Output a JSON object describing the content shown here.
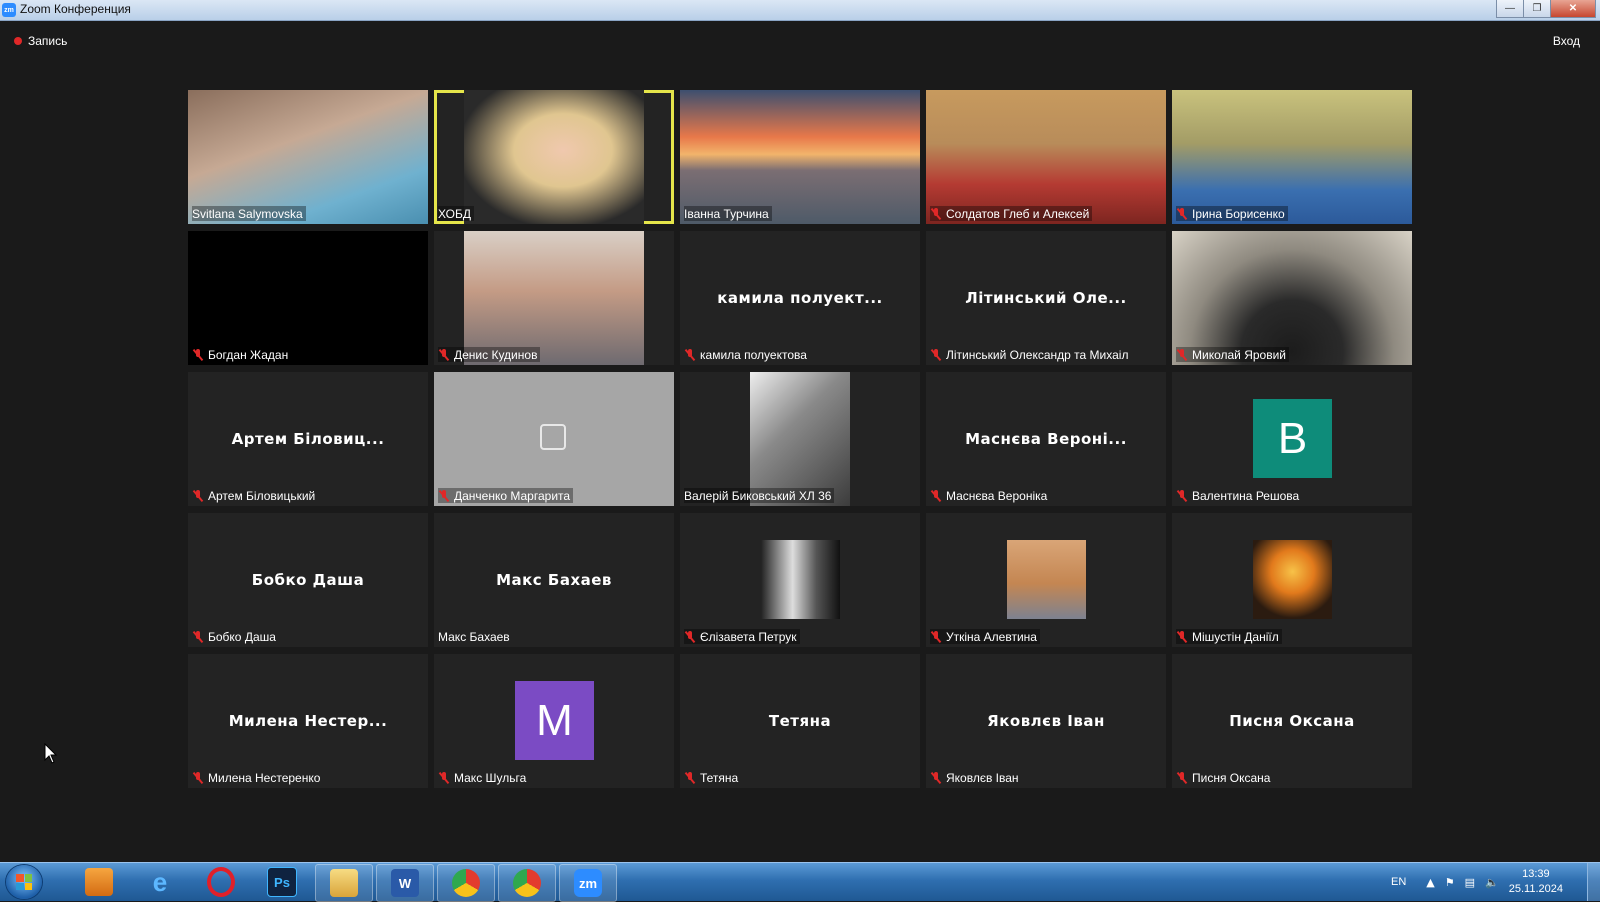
{
  "window": {
    "title": "Zoom Конференция",
    "app_icon": "zm"
  },
  "topbar": {
    "recording_label": "Запись",
    "enter_label": "Вход"
  },
  "participants": [
    {
      "name": "Svitlana Salymovska",
      "muted": false,
      "video": "woman-turquoise"
    },
    {
      "name": "ХОБД",
      "muted": false,
      "video": "woman-blonde",
      "active": true
    },
    {
      "name": "Іванна Турчина",
      "muted": false,
      "video": "golden-gate"
    },
    {
      "name": "Солдатов Глеб и Алексей",
      "muted": true,
      "video": "boy-red"
    },
    {
      "name": "Ірина Борисенко",
      "muted": true,
      "video": "woman-classroom"
    },
    {
      "name": "Богдан Жадан",
      "muted": true,
      "video": "black"
    },
    {
      "name": "Денис Кудинов",
      "muted": true,
      "video": "boy-hand"
    },
    {
      "name": "камила полуектова",
      "display": "камила полуект...",
      "muted": true
    },
    {
      "name": "Літинський Олександр та Михаіл",
      "display": "Літинський Оле...",
      "muted": true
    },
    {
      "name": "Миколай Яровий",
      "muted": true,
      "video": "dark-window"
    },
    {
      "name": "Артем Біловицький",
      "display": "Артем Біловиц...",
      "muted": true
    },
    {
      "name": "Данченко Маргарита",
      "muted": true,
      "video": "grey-camera"
    },
    {
      "name": "Валерій Биковський ХЛ 36",
      "muted": false,
      "video": "ceiling"
    },
    {
      "name": "Маснєва Вероніка",
      "display": "Маснєва Вероні...",
      "muted": true
    },
    {
      "name": "Валентина Решова",
      "muted": true,
      "letter": "В",
      "letter_color": "#0e8c7a"
    },
    {
      "name": "Бобко Даша",
      "display": "Бобко Даша",
      "muted": true
    },
    {
      "name": "Макс Бахаев",
      "display": "Макс Бахаев",
      "muted": false
    },
    {
      "name": "Єлізавета Петрук",
      "muted": true,
      "video": "photo-bw"
    },
    {
      "name": "Уткіна Алевтина",
      "muted": true,
      "video": "photo-cat"
    },
    {
      "name": "Мішустін Даніїл",
      "muted": true,
      "video": "photo-robot"
    },
    {
      "name": "Милена Нестеренко",
      "display": "Милена Нестер...",
      "muted": true
    },
    {
      "name": "Макс Шульга",
      "muted": true,
      "letter": "M",
      "letter_color": "#7b4bc4"
    },
    {
      "name": "Тетяна",
      "display": "Тетяна",
      "muted": true
    },
    {
      "name": "Яковлєв Іван",
      "display": "Яковлєв Іван",
      "muted": true
    },
    {
      "name": "Писня Оксана",
      "display": "Писня Оксана",
      "muted": true
    }
  ],
  "taskbar": {
    "items": [
      {
        "icon": "media-player-icon"
      },
      {
        "icon": "internet-explorer-icon"
      },
      {
        "icon": "opera-icon"
      },
      {
        "icon": "photoshop-icon",
        "label": "Ps"
      },
      {
        "icon": "file-explorer-icon"
      },
      {
        "icon": "word-icon",
        "label": "W"
      },
      {
        "icon": "chrome-icon"
      },
      {
        "icon": "chrome-icon"
      },
      {
        "icon": "zoom-icon",
        "label": "zm"
      }
    ],
    "language": "EN",
    "time": "13:39",
    "date": "25.11.2024"
  }
}
